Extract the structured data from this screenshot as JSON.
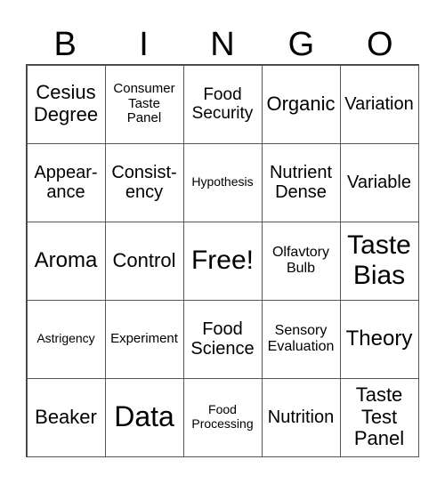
{
  "header": {
    "letters": [
      "B",
      "I",
      "N",
      "G",
      "O"
    ]
  },
  "grid": {
    "rows": [
      [
        "Cesius\nDegree",
        "Consumer\nTaste\nPanel",
        "Food\nSecurity",
        "Organic",
        "Variation"
      ],
      [
        "Appear-\nance",
        "Consist-\nency",
        "Hypothesis",
        "Nutrient\nDense",
        "Variable"
      ],
      [
        "Aroma",
        "Control",
        "Free!",
        "Olfavtory\nBulb",
        "Taste\nBias"
      ],
      [
        "Astrigency",
        "Experiment",
        "Food\nScience",
        "Sensory\nEvaluation",
        "Theory"
      ],
      [
        "Beaker",
        "Data",
        "Food\nProcessing",
        "Nutrition",
        "Taste\nTest\nPanel"
      ]
    ],
    "free_space": "Free!"
  },
  "colors": {
    "text": "#000000",
    "grid_line": "#555555",
    "background": "#ffffff"
  }
}
